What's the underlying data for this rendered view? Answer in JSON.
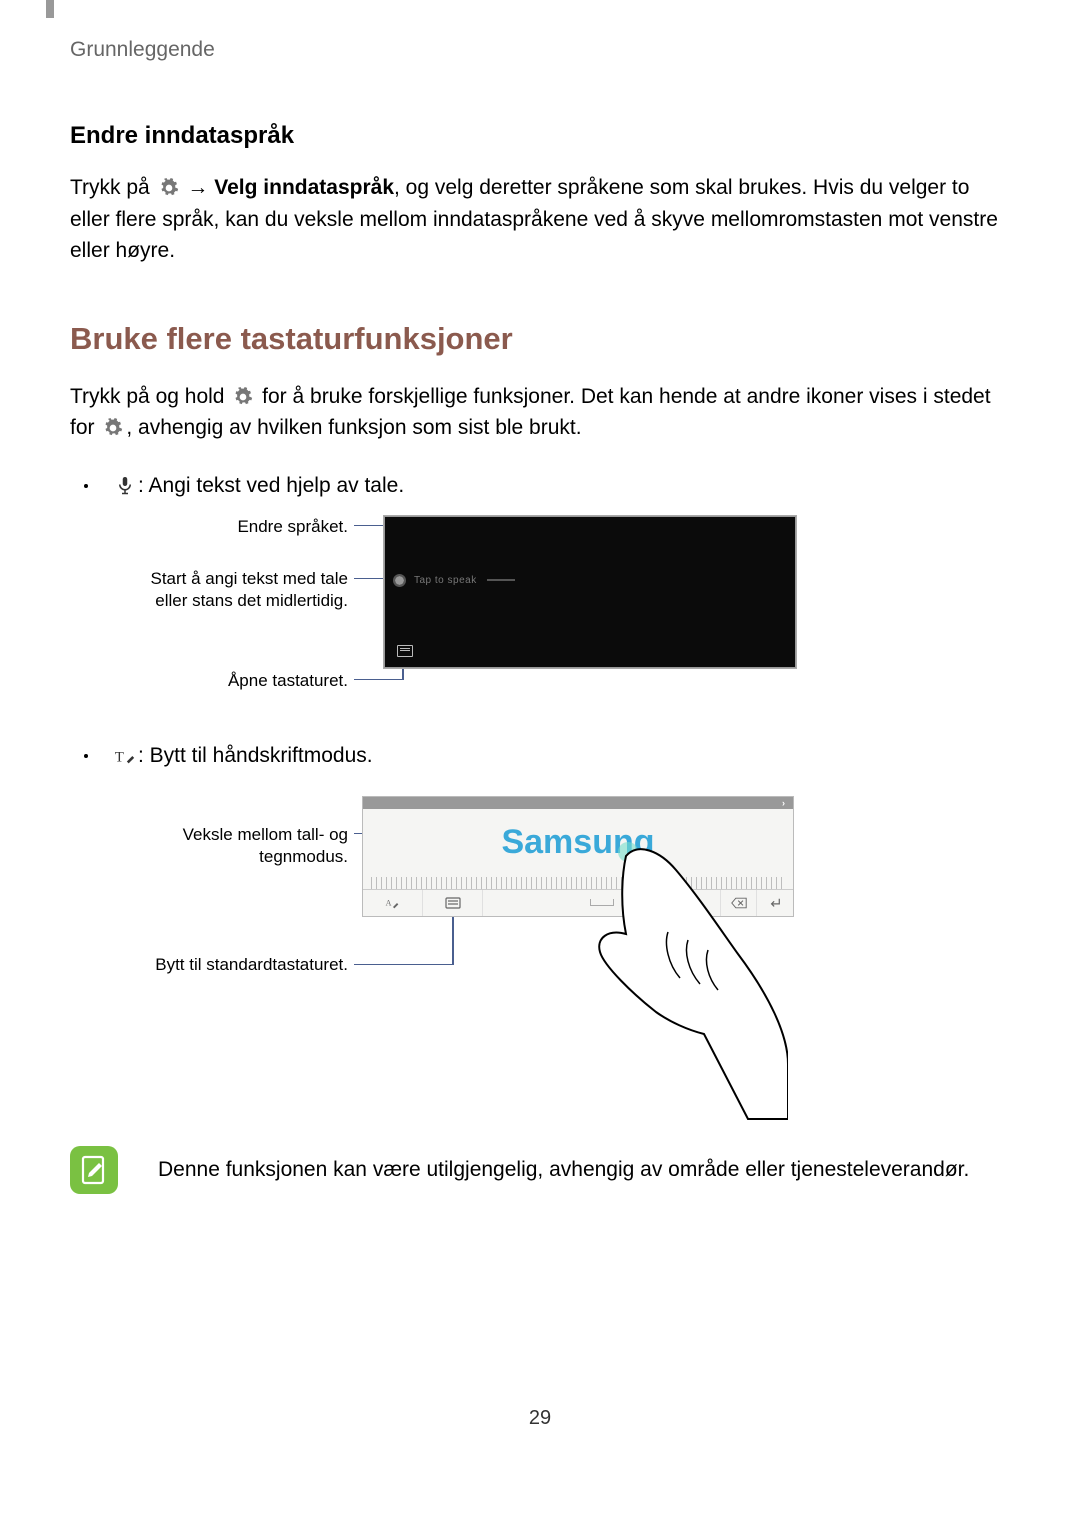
{
  "breadcrumb": "Grunnleggende",
  "section1": {
    "heading": "Endre inndataspråk",
    "p1_before": "Trykk på ",
    "p1_bold": "Velg inndataspråk",
    "p1_after": ", og velg deretter språkene som skal brukes. Hvis du velger to eller flere språk, kan du veksle mellom inndataspråkene ved å skyve mellomromstasten mot venstre eller høyre."
  },
  "section2": {
    "heading": "Bruke flere tastaturfunksjoner",
    "p1a": "Trykk på og hold ",
    "p1b": " for å bruke forskjellige funksjoner. Det kan hende at andre ikoner vises i stedet for ",
    "p1c": ", avhengig av hvilken funksjon som sist ble brukt.",
    "bullet_mic": ": Angi tekst ved hjelp av tale.",
    "bullet_hand": " : Bytt til håndskriftmodus."
  },
  "diagram1": {
    "c1": "Endre språket.",
    "c2": "Start å angi tekst med tale eller stans det midlertidig.",
    "c3": "Åpne tastaturet.",
    "tap": "Tap to speak"
  },
  "diagram2": {
    "c1": "Veksle mellom tall- og tegnmodus.",
    "c2": "Bytt til standardtastaturet.",
    "handwriting": "Samsung"
  },
  "note": "Denne funksjonen kan være utilgjengelig, avhengig av område eller tjenesteleverandør.",
  "page_number": "29"
}
